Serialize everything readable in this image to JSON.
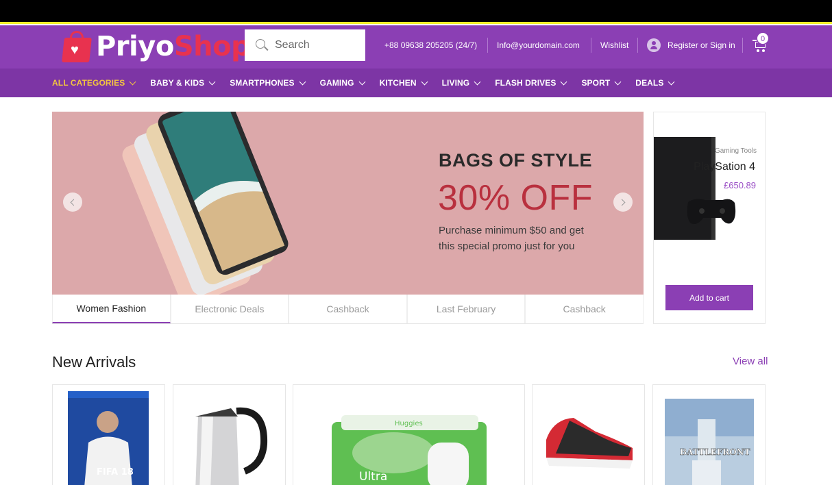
{
  "brand": {
    "logo_part1": "Priyo",
    "logo_part2": "Shop",
    "accent": "#8b3fb4",
    "logo_red": "#e8324f",
    "nav_active": "#f3c440"
  },
  "search": {
    "placeholder": "Search"
  },
  "header": {
    "phone": "+88 09638 205205 (24/7)",
    "email": "Info@yourdomain.com",
    "wishlist": "Wishlist",
    "register": "Register or Sign in",
    "cart_count": "0"
  },
  "nav": {
    "items": [
      {
        "label": "ALL CATEGORIES",
        "active": true
      },
      {
        "label": "BABY & KIDS"
      },
      {
        "label": "SMARTPHONES"
      },
      {
        "label": "GAMING"
      },
      {
        "label": "KITCHEN"
      },
      {
        "label": "LIVING"
      },
      {
        "label": "FLASH DRIVES"
      },
      {
        "label": "SPORT"
      },
      {
        "label": "DEALS"
      }
    ]
  },
  "banner": {
    "title": "BAGS OF STYLE",
    "discount": "30% OFF",
    "description": "Purchase minimum $50 and get this special promo just for you"
  },
  "tabs": [
    {
      "label": "Women Fashion",
      "active": true
    },
    {
      "label": "Electronic Deals"
    },
    {
      "label": "Cashback"
    },
    {
      "label": "Last February"
    },
    {
      "label": "Cashback"
    }
  ],
  "promo": {
    "category": "Gaming Tools",
    "name": "PlaySation 4",
    "price": "£650.89",
    "add_to_cart": "Add to cart"
  },
  "new_arrivals": {
    "title": "New Arrivals",
    "view_all": "View all",
    "products": [
      {
        "icon": "fifa-game-cover",
        "cover_text": "FIFA 18"
      },
      {
        "icon": "electric-kettle"
      },
      {
        "icon": "diapers-pack",
        "brand_text": "Huggies",
        "pack_text": "Ultra"
      },
      {
        "icon": "sneaker"
      },
      {
        "icon": "battlefront-game-cover",
        "cover_text": "BATTLEFRONT"
      }
    ]
  }
}
